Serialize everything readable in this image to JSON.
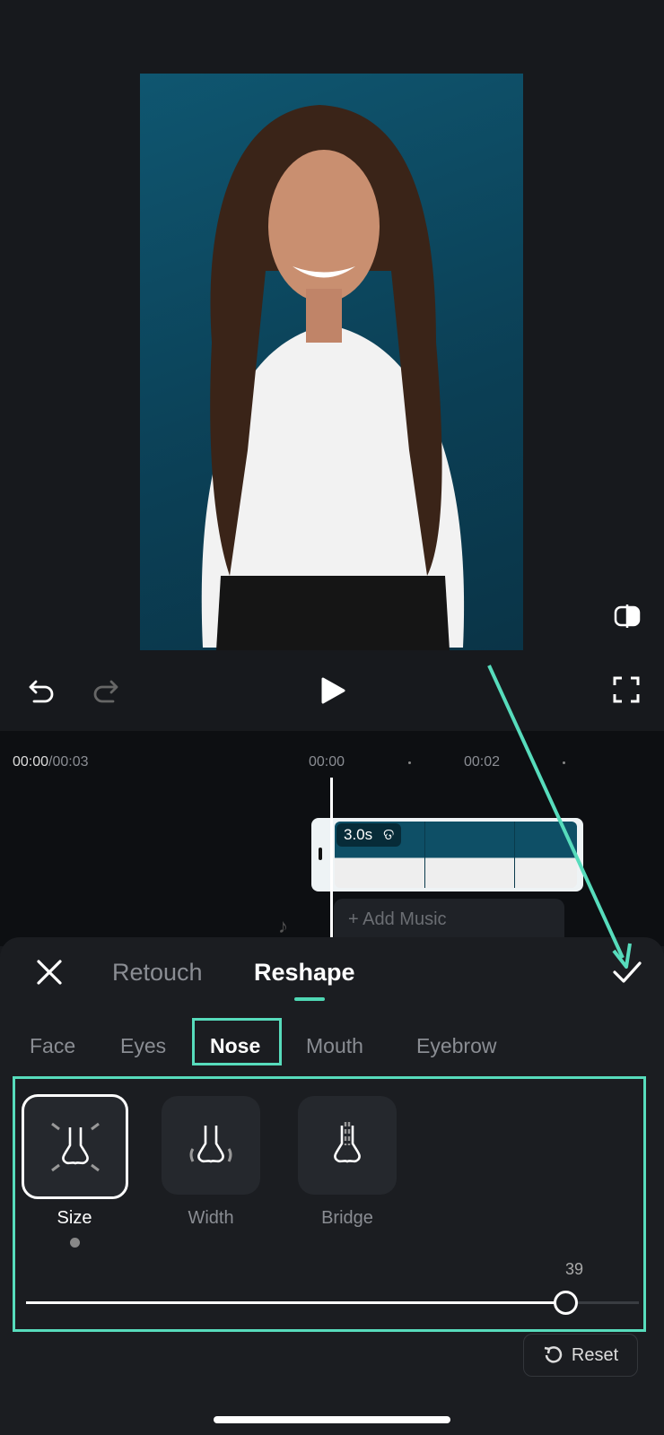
{
  "timeline": {
    "current": "00:00",
    "total": "/00:03",
    "ruler": [
      "00:00",
      "00:02"
    ],
    "clip_duration": "3.0s",
    "add_music": "Add Music"
  },
  "panel": {
    "tabs": [
      "Retouch",
      "Reshape"
    ],
    "active_tab": "Reshape",
    "subtabs": [
      "Face",
      "Eyes",
      "Nose",
      "Mouth",
      "Eyebrow"
    ],
    "active_subtab": "Nose",
    "options": [
      {
        "label": "Size",
        "icon": "nose-size-icon"
      },
      {
        "label": "Width",
        "icon": "nose-width-icon"
      },
      {
        "label": "Bridge",
        "icon": "nose-bridge-icon"
      }
    ],
    "selected_option": "Size",
    "slider_value": "39",
    "slider_percent": 88,
    "reset": "Reset"
  },
  "colors": {
    "accent": "#4fd8b4",
    "annotation": "#57dcbc"
  }
}
